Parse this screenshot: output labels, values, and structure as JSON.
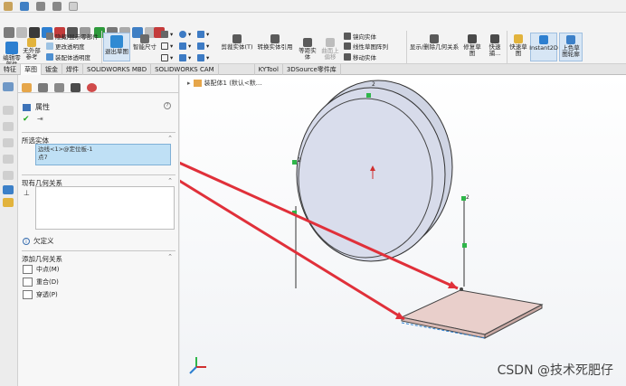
{
  "ribbon": {
    "edit_sketch": "编辑零部件",
    "no_external_ref": "无外部参考",
    "hide_show_parts": "隐藏/显示零部件",
    "change_transparency": "更改透明度",
    "assembly_transparency": "装配体透明度",
    "exit_sketch": "退出草图",
    "smart_dimension": "智能尺寸",
    "trim_entities": "剪裁实体(T)",
    "convert_entities": "转换实体引用",
    "offset_entities": "等距实体",
    "surface_offset": "曲面上偏移",
    "mirror_entities": "镜向实体",
    "linear_pattern": "线性草图阵列",
    "move_entities": "移动实体",
    "display_delete_relations": "显示/删除几何关系",
    "repair_sketch": "修复草图",
    "quick_snaps": "快速捕...",
    "rapid_sketch": "快速草图",
    "instant2d": "Instant2D",
    "shaded_sketch": "上色草图轮廓"
  },
  "tabs": [
    "特征",
    "草图",
    "钣金",
    "焊件",
    "SOLIDWORKS MBD",
    "SOLIDWORKS CAM",
    "",
    "KYTool",
    "3DSource零件库"
  ],
  "active_tab_index": 1,
  "property_manager": {
    "title": "属性",
    "help": "?",
    "selected_entities_header": "所选实体",
    "selected_items": [
      "边线<1>@定位板-1",
      "点7"
    ],
    "existing_relations_header": "现有几何关系",
    "status_text": "欠定义",
    "add_relations_header": "添加几何关系",
    "relations": [
      "中点(M)",
      "重合(D)",
      "穿透(P)"
    ]
  },
  "viewport": {
    "breadcrumb": "装配体1 (默认<默...",
    "point_labels": [
      "2",
      "2",
      "2"
    ],
    "watermark": "CSDN @技术死肥仔"
  },
  "colors": {
    "accent": "#2d7fd0",
    "arrow": "#e0303a",
    "selection": "#bfe0f5",
    "wheel_fill": "#d7dbea",
    "plate_fill": "#e9cfcb",
    "point_green": "#2fb64a"
  }
}
